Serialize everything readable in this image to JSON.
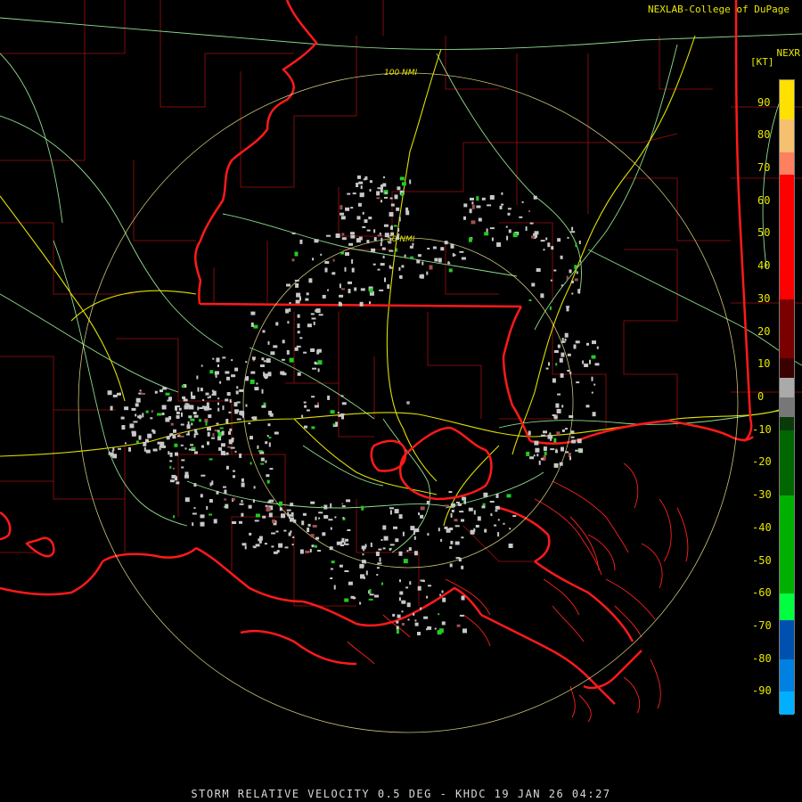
{
  "header": {
    "credit": "NEXLAB-College of DuPage",
    "product": "NEXR",
    "units": "[KT]"
  },
  "map": {
    "range_rings": [
      {
        "label": "50 NMI",
        "radius_nmi": 50
      },
      {
        "label": "100 NMI",
        "radius_nmi": 100
      }
    ],
    "colors": {
      "state_borders": "#ff1a1a",
      "county_borders": "#b01010",
      "highways": "#e8e800",
      "roads": "#8fdc8f",
      "range_rings": "#f0e68c",
      "echo_light": "#c8c8c8",
      "echo_gate": "#22cc22"
    }
  },
  "legend": {
    "ticks": [
      "90",
      "80",
      "70",
      "60",
      "50",
      "40",
      "30",
      "20",
      "10",
      "0",
      "-10",
      "-20",
      "-30",
      "-40",
      "-50",
      "-60",
      "-70",
      "-80",
      "-90"
    ],
    "gradient": [
      {
        "from": 95,
        "color": "#ffe000"
      },
      {
        "from": 85,
        "color": "#f5c070"
      },
      {
        "from": 75,
        "color": "#ff8060"
      },
      {
        "from": 68,
        "color": "#ff0000"
      },
      {
        "from": 30,
        "color": "#7a0000"
      },
      {
        "from": 12,
        "color": "#3a0000"
      },
      {
        "from": 6,
        "color": "#aaaaaa"
      },
      {
        "from": 0,
        "color": "#777777"
      },
      {
        "from": -6,
        "color": "#0a3a0a"
      },
      {
        "from": -10,
        "color": "#006600"
      },
      {
        "from": -30,
        "color": "#00b000"
      },
      {
        "from": -60,
        "color": "#00ff40"
      },
      {
        "from": -68,
        "color": "#0050b0"
      },
      {
        "from": -80,
        "color": "#0080e0"
      },
      {
        "from": -90,
        "color": "#00b0ff"
      }
    ]
  },
  "caption": {
    "text": "STORM RELATIVE VELOCITY 0.5 DEG - KHDC 19 JAN 26 04:27"
  }
}
